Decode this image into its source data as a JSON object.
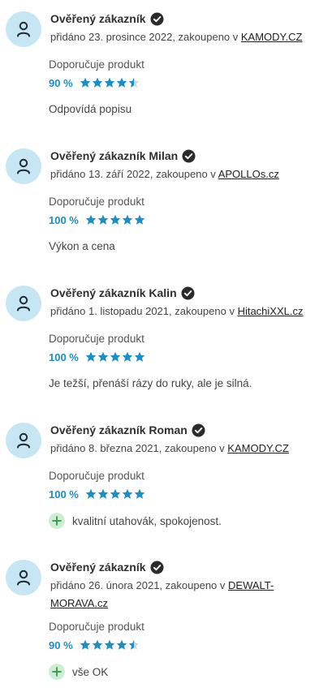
{
  "colors": {
    "accent": "#1a8ec7",
    "star": "#1a8ec7",
    "avatar_bg": "#c6e6f4",
    "pro_bg": "#cdeed4",
    "pro_plus": "#2f9a46"
  },
  "icons": {
    "avatar": "user-icon",
    "verified": "check-badge-icon",
    "star": "star-icon",
    "pro": "plus-icon"
  },
  "reviews": [
    {
      "name": "Ověřený zákazník",
      "added_prefix": "přidáno 23. prosince 2022, zakoupeno v ",
      "shop": "KAMODY.CZ",
      "recommend": "Doporučuje produkt",
      "rating_pct": "90 %",
      "rating": 4.5,
      "comment": "Odpovídá popisu",
      "pro": ""
    },
    {
      "name": "Ověřený zákazník Milan",
      "added_prefix": "přidáno 13. září 2022, zakoupeno v ",
      "shop": "APOLLOs.cz",
      "recommend": "Doporučuje produkt",
      "rating_pct": "100 %",
      "rating": 5,
      "comment": "Výkon a cena",
      "pro": ""
    },
    {
      "name": "Ověřený zákazník Kalin",
      "added_prefix": "přidáno 1. listopadu 2021, zakoupeno v ",
      "shop": "HitachiXXL.cz",
      "recommend": "Doporučuje produkt",
      "rating_pct": "100 %",
      "rating": 5,
      "comment": "Je težší, přenáší rázy do ruky, ale je silná.",
      "pro": ""
    },
    {
      "name": "Ověřený zákazník Roman",
      "added_prefix": "přidáno 8. března 2021, zakoupeno v ",
      "shop": "KAMODY.CZ",
      "recommend": "Doporučuje produkt",
      "rating_pct": "100 %",
      "rating": 5,
      "comment": "",
      "pro": "kvalitní utahovák, spokojenost."
    },
    {
      "name": "Ověřený zákazník",
      "added_prefix": "přidáno 26. února 2021, zakoupeno v ",
      "shop": "DEWALT-MORAVA.cz",
      "recommend": "Doporučuje produkt",
      "rating_pct": "90 %",
      "rating": 4.5,
      "comment": "",
      "pro": "vše OK"
    }
  ]
}
